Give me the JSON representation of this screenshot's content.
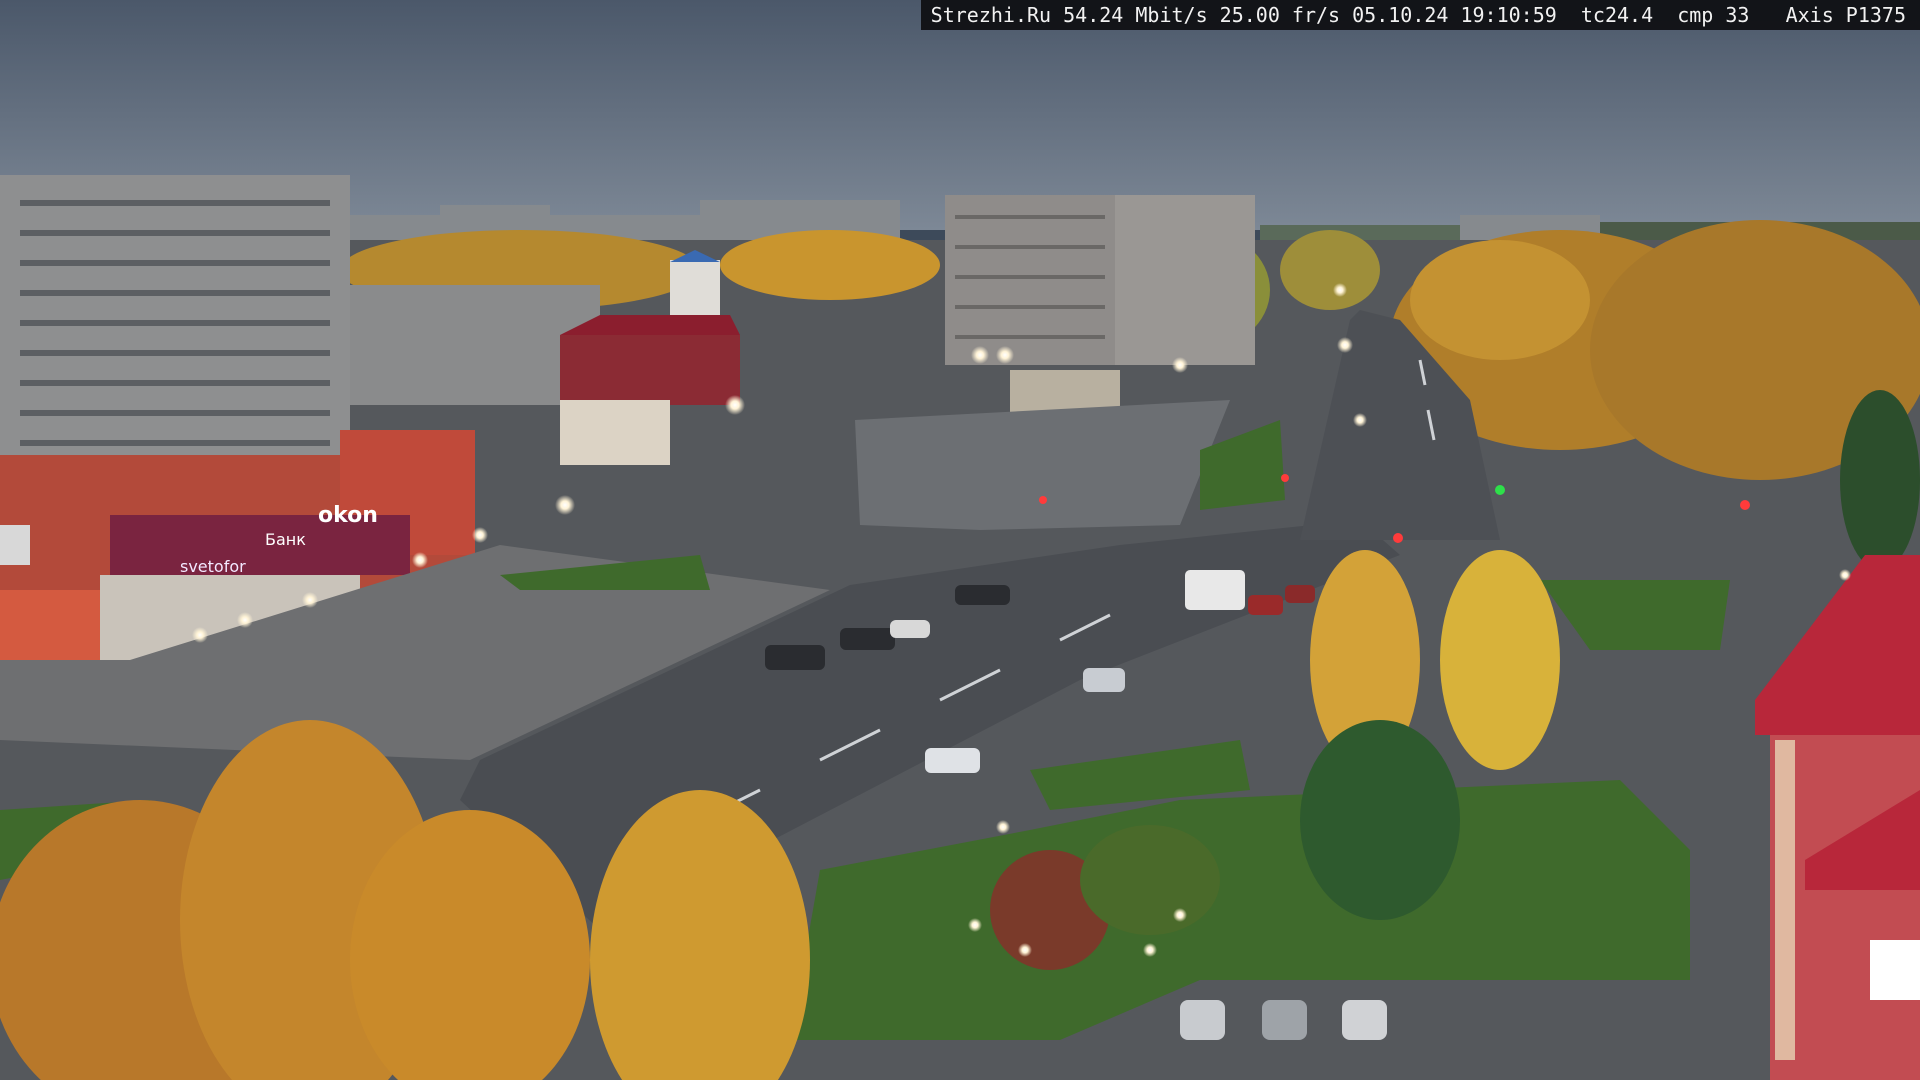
{
  "overlay": {
    "text": "Strezhi.Ru 54.24 Mbit/s 25.00 fr/s 05.10.24 19:10:59  tc24.4  cmp 33   Axis P1375"
  },
  "signage": {
    "store_sign_1": "svetofor",
    "store_sign_2": "okon",
    "store_sign_3": "Банк"
  },
  "colors": {
    "sky": "#5b6a7c",
    "road": "#4a4d52",
    "foliage_orange": "#c98a2a",
    "foliage_yellow": "#d8b23a",
    "grass": "#3f6a2c",
    "building_grey": "#8e8f90",
    "building_red": "#b34a3a",
    "roof_red": "#b8273a"
  }
}
